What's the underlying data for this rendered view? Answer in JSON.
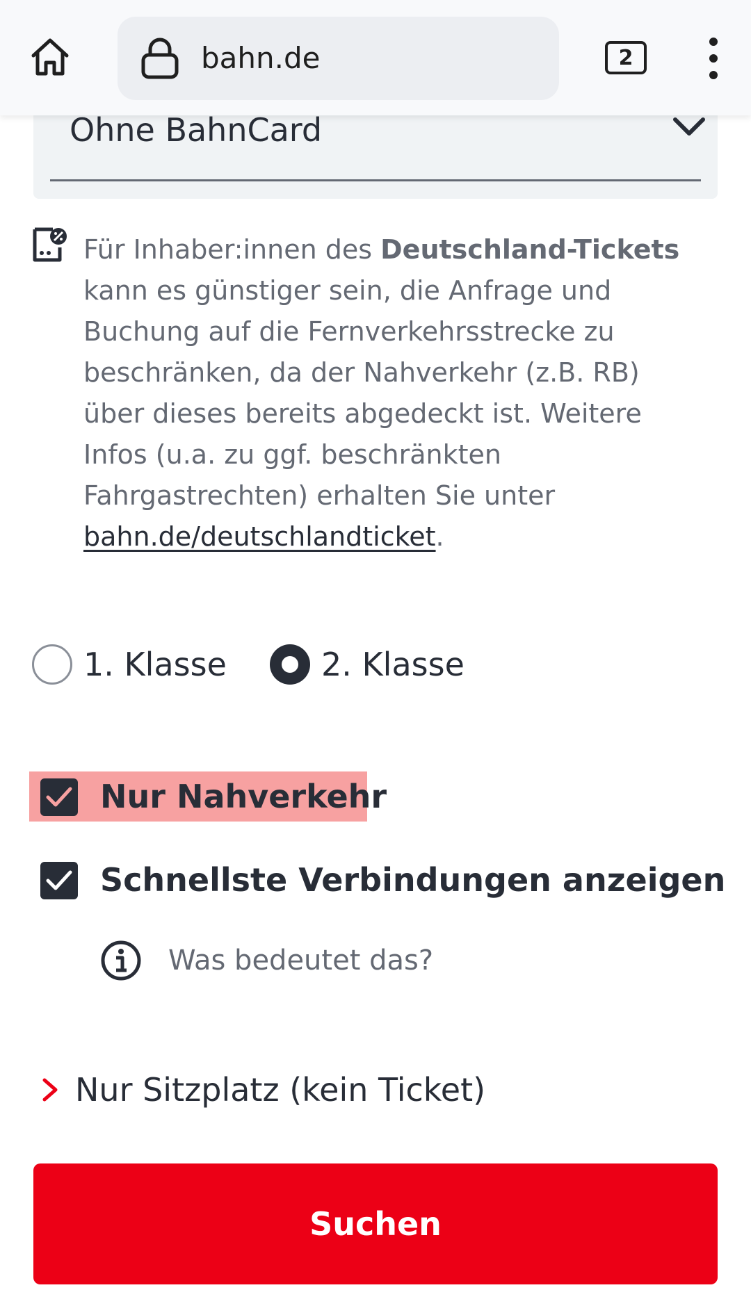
{
  "browser": {
    "url": "bahn.de",
    "tab_count": "2",
    "icons": {
      "home": "home-icon",
      "lock": "lock-icon",
      "tabs": "tabs-icon",
      "menu": "more-vert-icon"
    }
  },
  "bahncard": {
    "selected": "Ohne BahnCard",
    "icon": "chevron-down-icon"
  },
  "notice": {
    "icon": "ticket-percent-icon",
    "line1_pre": "Für Inhaber:innen des ",
    "line1_bold": "Deutschland-Tickets",
    "line2": "kann es günstiger sein, die Anfrage und",
    "line3": "Buchung auf die Fernverkehrsstrecke zu",
    "line4": "beschränken, da der Nahverkehr (z.B. RB)",
    "line5": "über dieses bereits abgedeckt ist. Weitere",
    "line6": "Infos (u.a. zu ggf. beschränkten",
    "line7": "Fahrgastrechten) erhalten Sie unter",
    "link_text": "bahn.de/deutschlandticket",
    "link_suffix": "."
  },
  "travel_class": {
    "options": [
      {
        "label": "1. Klasse",
        "selected": false
      },
      {
        "label": "2. Klasse",
        "selected": true
      }
    ]
  },
  "options": {
    "nur_nahverkehr": {
      "label": "Nur Nahverkehr",
      "checked": true,
      "highlight_color": "#f7a1a1"
    },
    "schnellste": {
      "label": "Schnellste Verbindungen anzeigen",
      "checked": true
    },
    "info_link": {
      "label": "Was bedeutet das?",
      "icon": "info-icon"
    }
  },
  "seat_only": {
    "label": "Nur Sitzplatz (kein Ticket)",
    "icon": "chevron-right-icon",
    "icon_color": "#ec0016"
  },
  "search": {
    "label": "Suchen",
    "color": "#ec0016"
  }
}
